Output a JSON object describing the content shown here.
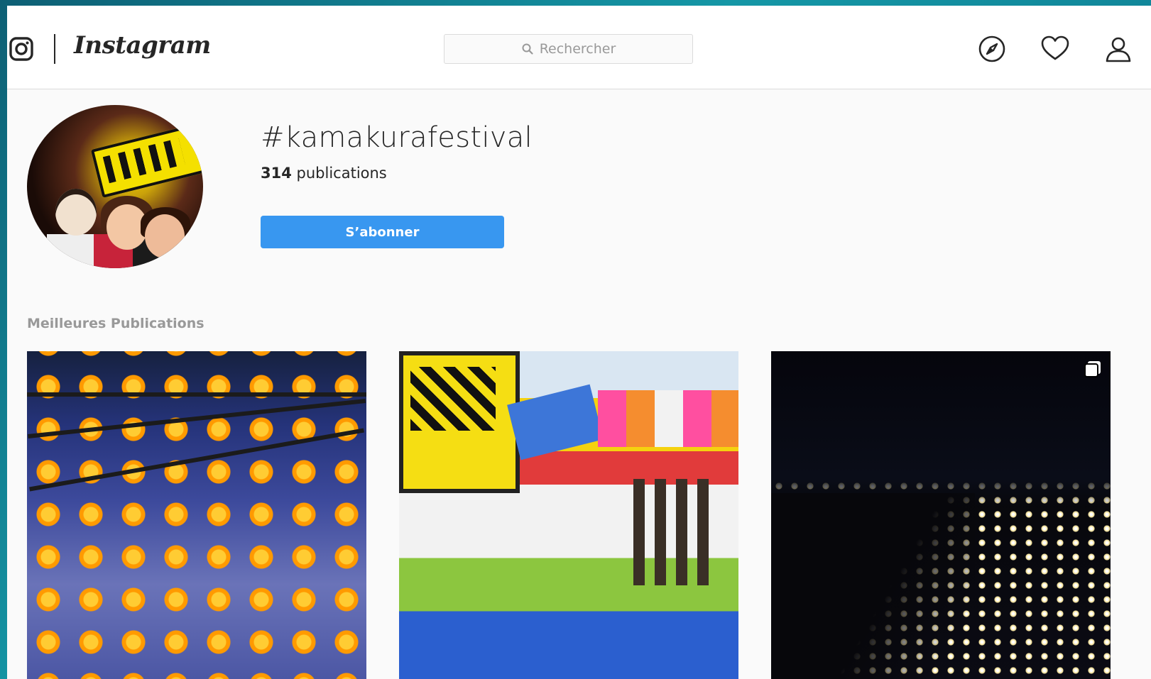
{
  "header": {
    "wordmark": "Instagram",
    "search": {
      "placeholder": "Rechercher"
    },
    "icons": [
      "instagram-glyph-icon",
      "explore-compass-icon",
      "heart-icon",
      "profile-icon",
      "search-icon"
    ]
  },
  "profile": {
    "hashtag": "#kamakurafestival",
    "count": "314",
    "count_label": "publications",
    "follow_label": "S’abonner"
  },
  "section": {
    "title": "Meilleures Publications"
  },
  "posts": [
    {
      "description": "snow lanterns at night",
      "multi": false
    },
    {
      "description": "festival food stalls",
      "multi": false
    },
    {
      "description": "night lantern field",
      "multi": true
    }
  ],
  "colors": {
    "accent": "#3897f0",
    "text": "#262626",
    "muted": "#999999",
    "background": "#fafafa",
    "border": "#dbdbdb"
  }
}
